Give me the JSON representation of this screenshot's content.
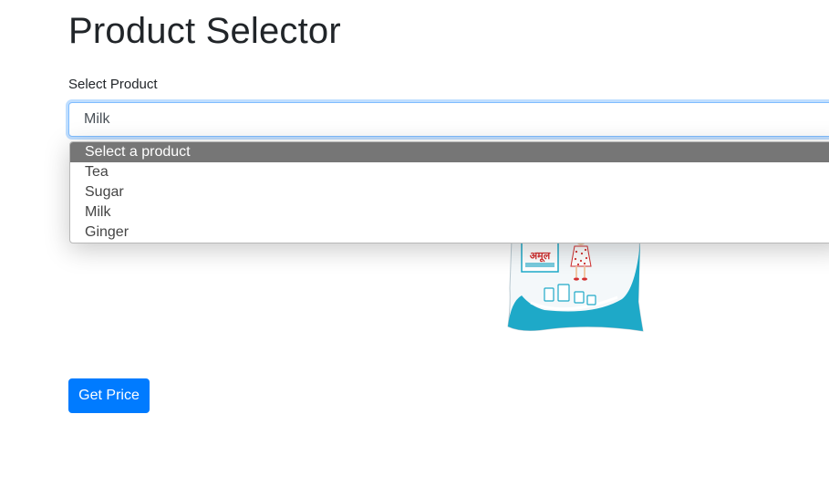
{
  "page": {
    "title": "Product Selector"
  },
  "form": {
    "select_label": "Select Product",
    "selected_value": "Milk",
    "options": [
      "Select a product",
      "Tea",
      "Sugar",
      "Milk",
      "Ginger"
    ],
    "highlighted_option": "Select a product",
    "button_label": "Get Price"
  },
  "product_image": {
    "alt": "Milk pouch",
    "logo_text": "अमूल",
    "colors": {
      "pouch": "#f4f8fa",
      "accent": "#1ea9c8",
      "logo_red": "#d32f2f"
    }
  },
  "colors": {
    "primary": "#007bff",
    "focus_border": "#80bdff",
    "highlight": "#767676",
    "text": "#212529"
  }
}
